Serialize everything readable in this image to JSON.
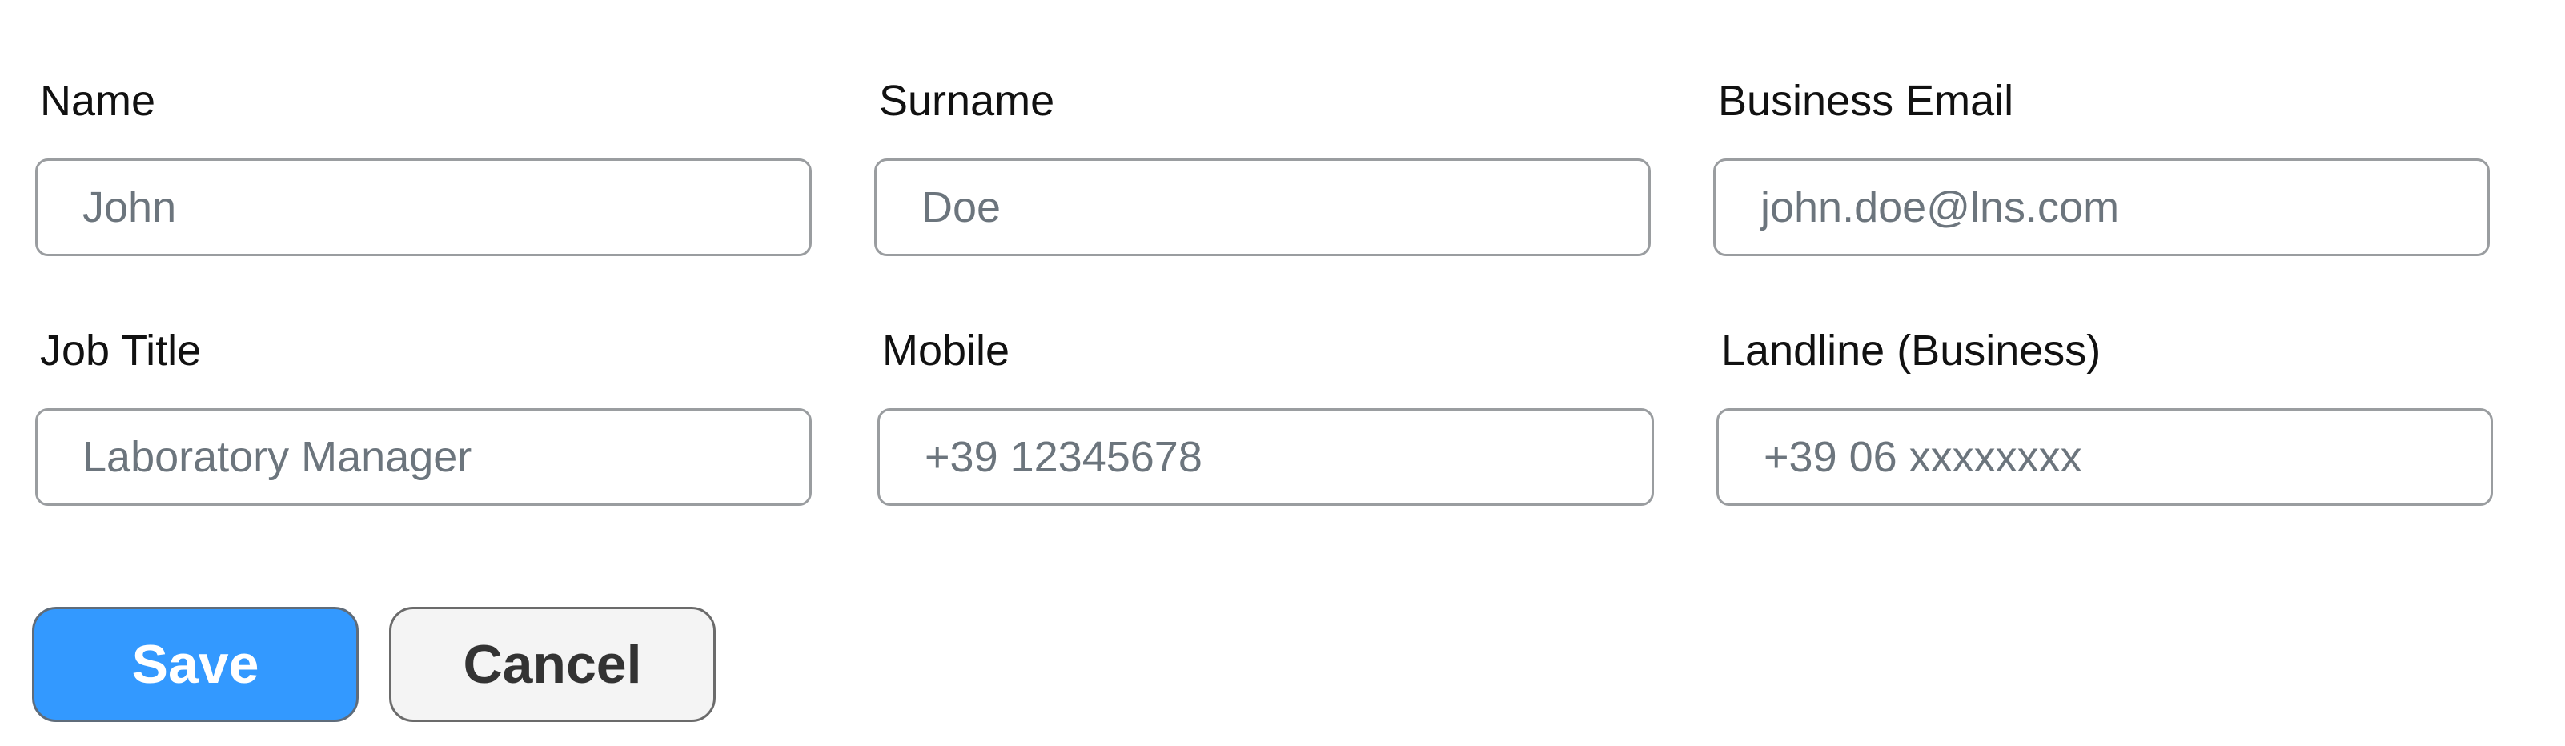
{
  "form": {
    "fields": {
      "name": {
        "label": "Name",
        "value": "",
        "placeholder": "John"
      },
      "surname": {
        "label": "Surname",
        "value": "",
        "placeholder": "Doe"
      },
      "email": {
        "label": "Business Email",
        "value": "",
        "placeholder": "john.doe@lns.com"
      },
      "job_title": {
        "label": "Job Title",
        "value": "",
        "placeholder": "Laboratory Manager"
      },
      "mobile": {
        "label": "Mobile",
        "value": "",
        "placeholder": "+39 12345678"
      },
      "landline": {
        "label": "Landline (Business)",
        "value": "",
        "placeholder": "+39 06 xxxxxxxx"
      }
    },
    "actions": {
      "save_label": "Save",
      "cancel_label": "Cancel"
    }
  },
  "colors": {
    "save_button_bg": "#3399ff",
    "cancel_button_bg": "#f4f4f4",
    "input_border": "#9a9da0",
    "placeholder_text": "#6c757d"
  }
}
